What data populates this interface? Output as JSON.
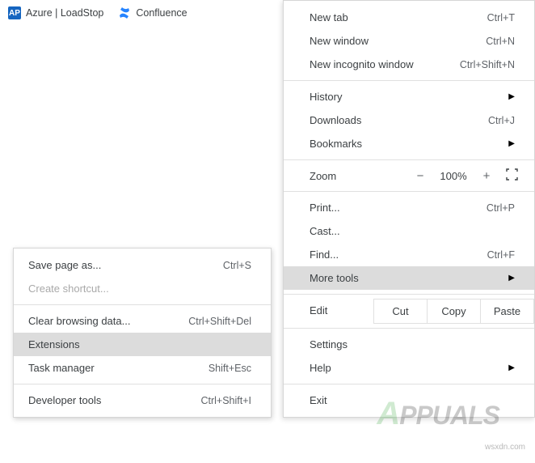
{
  "bookmarks": {
    "items": [
      {
        "label": "Azure | LoadStop",
        "icon_bg": "#1565c0",
        "icon_text": "AP"
      },
      {
        "label": "Confluence",
        "icon_bg": "#2684ff",
        "icon_text": ""
      }
    ]
  },
  "menu": {
    "new_tab": {
      "label": "New tab",
      "shortcut": "Ctrl+T"
    },
    "new_window": {
      "label": "New window",
      "shortcut": "Ctrl+N"
    },
    "new_incognito": {
      "label": "New incognito window",
      "shortcut": "Ctrl+Shift+N"
    },
    "history": {
      "label": "History"
    },
    "downloads": {
      "label": "Downloads",
      "shortcut": "Ctrl+J"
    },
    "bookmarks": {
      "label": "Bookmarks"
    },
    "zoom": {
      "label": "Zoom",
      "minus": "−",
      "value": "100%",
      "plus": "+"
    },
    "print": {
      "label": "Print...",
      "shortcut": "Ctrl+P"
    },
    "cast": {
      "label": "Cast..."
    },
    "find": {
      "label": "Find...",
      "shortcut": "Ctrl+F"
    },
    "more_tools": {
      "label": "More tools"
    },
    "edit": {
      "label": "Edit",
      "cut": "Cut",
      "copy": "Copy",
      "paste": "Paste"
    },
    "settings": {
      "label": "Settings"
    },
    "help": {
      "label": "Help"
    },
    "exit": {
      "label": "Exit"
    }
  },
  "submenu": {
    "save_page": {
      "label": "Save page as...",
      "shortcut": "Ctrl+S"
    },
    "create_shortcut": {
      "label": "Create shortcut..."
    },
    "clear_browsing": {
      "label": "Clear browsing data...",
      "shortcut": "Ctrl+Shift+Del"
    },
    "extensions": {
      "label": "Extensions"
    },
    "task_manager": {
      "label": "Task manager",
      "shortcut": "Shift+Esc"
    },
    "developer_tools": {
      "label": "Developer tools",
      "shortcut": "Ctrl+Shift+I"
    }
  },
  "watermark": {
    "text": "PPUALS",
    "site": "wsxdn.com"
  }
}
